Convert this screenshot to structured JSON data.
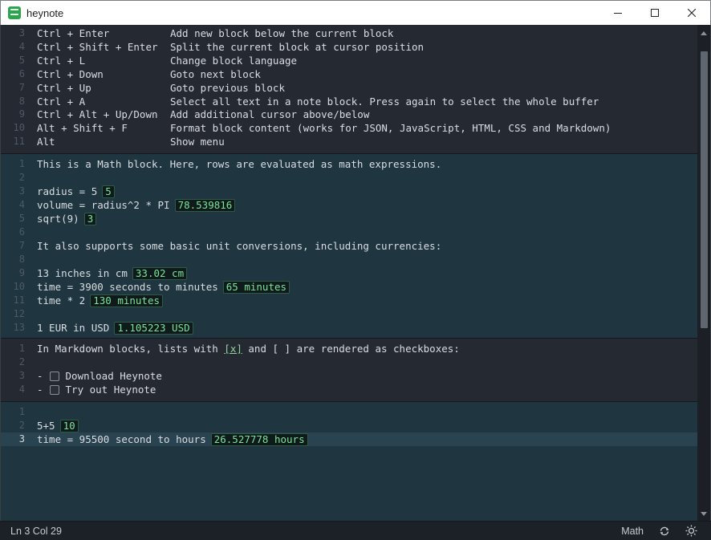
{
  "window": {
    "title": "heynote"
  },
  "text_block": {
    "lines": [
      {
        "num": "3",
        "key": "Ctrl + Enter",
        "desc": "Add new block below the current block"
      },
      {
        "num": "4",
        "key": "Ctrl + Shift + Enter",
        "desc": "Split the current block at cursor position"
      },
      {
        "num": "5",
        "key": "Ctrl + L",
        "desc": "Change block language"
      },
      {
        "num": "6",
        "key": "Ctrl + Down",
        "desc": "Goto next block"
      },
      {
        "num": "7",
        "key": "Ctrl + Up",
        "desc": "Goto previous block"
      },
      {
        "num": "8",
        "key": "Ctrl + A",
        "desc": "Select all text in a note block. Press again to select the whole buffer"
      },
      {
        "num": "9",
        "key": "Ctrl + Alt + Up/Down",
        "desc": "Add additional cursor above/below"
      },
      {
        "num": "10",
        "key": "Alt + Shift + F",
        "desc": "Format block content (works for JSON, JavaScript, HTML, CSS and Markdown)"
      },
      {
        "num": "11",
        "key": "Alt",
        "desc": "Show menu"
      }
    ]
  },
  "math_block": {
    "lines": [
      {
        "num": "1",
        "text": "This is a Math block. Here, rows are evaluated as math expressions.",
        "result": ""
      },
      {
        "num": "2",
        "text": "",
        "result": ""
      },
      {
        "num": "3",
        "text": "radius = 5",
        "result": "5"
      },
      {
        "num": "4",
        "text": "volume = radius^2 * PI",
        "result": "78.539816"
      },
      {
        "num": "5",
        "text": "sqrt(9)",
        "result": "3"
      },
      {
        "num": "6",
        "text": "",
        "result": ""
      },
      {
        "num": "7",
        "text": "It also supports some basic unit conversions, including currencies:",
        "result": ""
      },
      {
        "num": "8",
        "text": "",
        "result": ""
      },
      {
        "num": "9",
        "text": "13 inches in cm",
        "result": "33.02 cm"
      },
      {
        "num": "10",
        "text": "time = 3900 seconds to minutes",
        "result": "65 minutes"
      },
      {
        "num": "11",
        "text": "time * 2",
        "result": "130 minutes"
      },
      {
        "num": "12",
        "text": "",
        "result": ""
      },
      {
        "num": "13",
        "text": "1 EUR in USD",
        "result": "1.105223 USD"
      }
    ]
  },
  "markdown_block": {
    "line1": {
      "num": "1",
      "before": "In Markdown blocks, lists with ",
      "link": "[x]",
      "after": " and [ ] are rendered as checkboxes:"
    },
    "line2": {
      "num": "2"
    },
    "line3": {
      "num": "3",
      "bullet": "-",
      "label": "Download Heynote",
      "checked": false
    },
    "line4": {
      "num": "4",
      "bullet": "-",
      "label": "Try out Heynote",
      "checked": false
    }
  },
  "math_block_2": {
    "lines": [
      {
        "num": "1",
        "text": "",
        "result": ""
      },
      {
        "num": "2",
        "text": "5+5",
        "result": "10"
      },
      {
        "num": "3",
        "text": "time = 95500 second to hours",
        "result": "26.527778 hours"
      }
    ]
  },
  "status": {
    "position": "Ln 3 Col 29",
    "language": "Math",
    "icons": [
      "sync-icon",
      "theme-toggle-icon"
    ]
  },
  "colors": {
    "text_block_bg": "#252932",
    "math_block_bg": "#1f3540",
    "result_fg": "#7ce39a"
  }
}
